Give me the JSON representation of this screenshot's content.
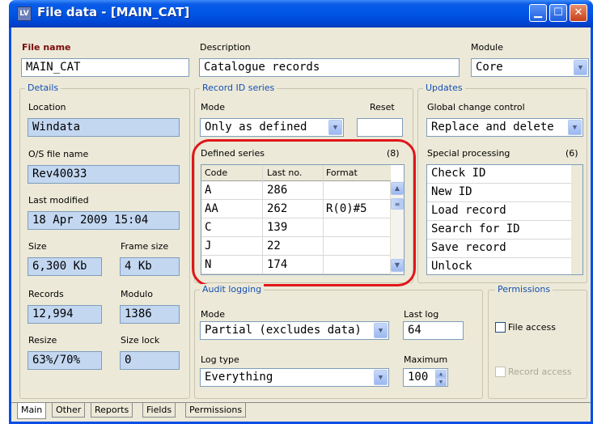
{
  "window": {
    "title": "File data - [MAIN_CAT]",
    "app_icon_text": "LV"
  },
  "file": {
    "name_label": "File name",
    "name_value": "MAIN_CAT"
  },
  "description": {
    "label": "Description",
    "value": "Catalogue records"
  },
  "module": {
    "label": "Module",
    "value": "Core"
  },
  "details": {
    "title": "Details",
    "location_label": "Location",
    "location_value": "Windata",
    "os_file_label": "O/S file name",
    "os_file_value": "Rev40033",
    "last_modified_label": "Last modified",
    "last_modified_value": "18 Apr 2009  15:04",
    "size_label": "Size",
    "size_value": "6,300 Kb",
    "frame_size_label": "Frame size",
    "frame_size_value": "4 Kb",
    "records_label": "Records",
    "records_value": "12,994",
    "modulo_label": "Modulo",
    "modulo_value": "1386",
    "resize_label": "Resize",
    "resize_value": "63%/70%",
    "size_lock_label": "Size lock",
    "size_lock_value": "0"
  },
  "record_id": {
    "title": "Record ID series",
    "mode_label": "Mode",
    "mode_value": "Only as defined",
    "reset_label": "Reset",
    "reset_value": "",
    "defined_label": "Defined series",
    "defined_count": "(8)",
    "columns": [
      "Code",
      "Last no.",
      "Format"
    ],
    "rows": [
      {
        "code": "A",
        "last": "286",
        "format": ""
      },
      {
        "code": "AA",
        "last": "262",
        "format": "R(0)#5"
      },
      {
        "code": "C",
        "last": "139",
        "format": ""
      },
      {
        "code": "J",
        "last": "22",
        "format": ""
      },
      {
        "code": "N",
        "last": "174",
        "format": ""
      }
    ]
  },
  "updates": {
    "title": "Updates",
    "global_label": "Global change control",
    "global_value": "Replace and delete",
    "special_label": "Special processing",
    "special_count": "(6)",
    "items": [
      "Check ID",
      "New ID",
      "Load record",
      "Search for ID",
      "Save record",
      "Unlock"
    ]
  },
  "audit": {
    "title": "Audit logging",
    "mode_label": "Mode",
    "mode_value": "Partial (excludes data)",
    "last_log_label": "Last log",
    "last_log_value": "64",
    "log_type_label": "Log type",
    "log_type_value": "Everything",
    "maximum_label": "Maximum",
    "maximum_value": "100"
  },
  "permissions": {
    "title": "Permissions",
    "file_access_label": "File access",
    "record_access_label": "Record access"
  },
  "tabs": [
    "Main",
    "Other",
    "Reports",
    "Fields",
    "Permissions"
  ],
  "colors": {
    "titlebar": "#0055e5",
    "highlight_ring": "#e0161a",
    "group_title": "#1450b4",
    "readonly_field": "#c3d7f1"
  }
}
